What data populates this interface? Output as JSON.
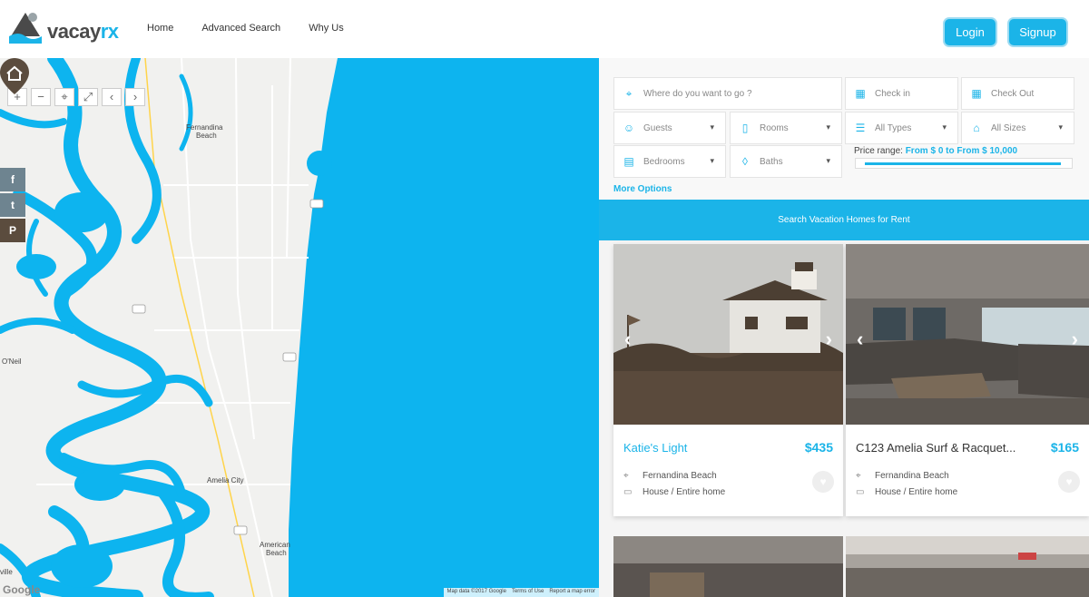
{
  "header": {
    "logo_text_main": "vacay",
    "logo_text_accent": "rx",
    "nav": [
      "Home",
      "Advanced Search",
      "Why Us"
    ],
    "login_label": "Login",
    "signup_label": "Signup"
  },
  "map": {
    "controls": [
      "+",
      "−",
      "⌖",
      "⤢",
      "‹",
      "›"
    ],
    "social": [
      "f",
      "t",
      "P"
    ],
    "labels": [
      {
        "text": "Fernandina"
      },
      {
        "text": "Beach"
      },
      {
        "text": "O'Neil"
      },
      {
        "text": "Amelia City"
      },
      {
        "text": "American"
      },
      {
        "text": "Beach"
      },
      {
        "text": "ville"
      }
    ],
    "footer": [
      "Map data ©2017 Google",
      "Terms of Use",
      "Report a map error"
    ],
    "google_label": "Google"
  },
  "search": {
    "where_placeholder": "Where do you want to go ?",
    "check_in": "Check in",
    "check_out": "Check Out",
    "guests": "Guests",
    "rooms": "Rooms",
    "all_types": "All Types",
    "all_sizes": "All Sizes",
    "bedrooms": "Bedrooms",
    "baths": "Baths",
    "price_label": "Price range:",
    "price_value": "From $ 0 to From $ 10,000",
    "price_fill_fraction": 1.0,
    "more_options": "More Options",
    "search_button": "Search Vacation Homes for Rent"
  },
  "listings": [
    {
      "title": "Katie's Light",
      "price": "$435",
      "location": "Fernandina Beach",
      "type": "House / Entire home"
    },
    {
      "title": "C123 Amelia Surf & Racquet...",
      "price": "$165",
      "location": "Fernandina Beach",
      "type": "House / Entire home"
    }
  ],
  "colors": {
    "accent": "#1bb4e8",
    "water": "#0db4ef",
    "pin": "#5b4c3e"
  }
}
